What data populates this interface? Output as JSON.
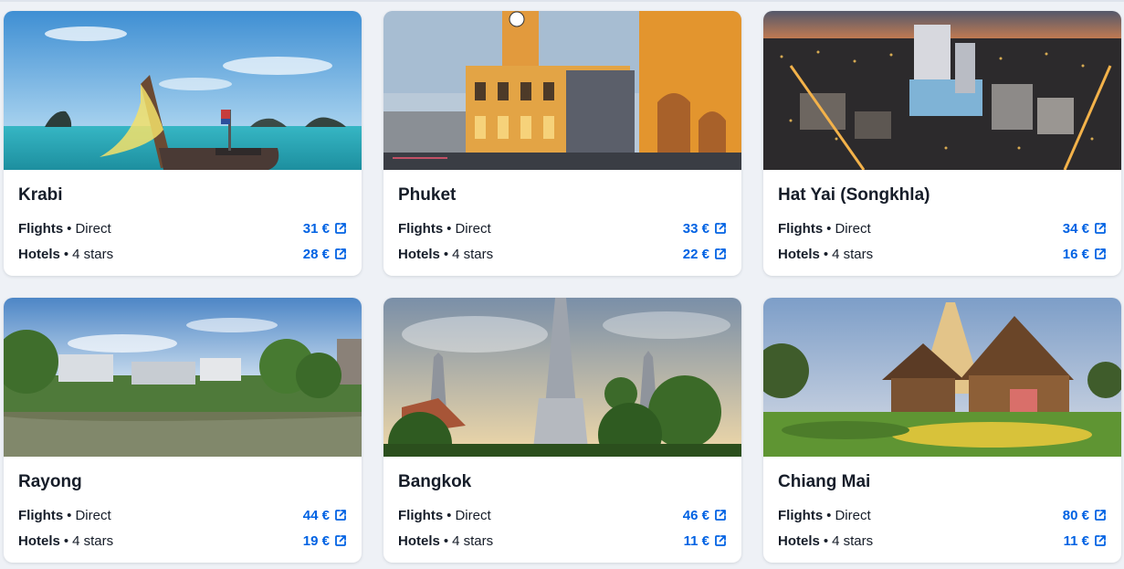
{
  "cards": [
    {
      "city": "Krabi",
      "flights_label": "Flights",
      "flights_detail": "Direct",
      "flights_price": "31 €",
      "hotels_label": "Hotels",
      "hotels_detail": "4 stars",
      "hotels_price": "28 €",
      "image": "krabi-beach-longtail-boat"
    },
    {
      "city": "Phuket",
      "flights_label": "Flights",
      "flights_detail": "Direct",
      "flights_price": "33 €",
      "hotels_label": "Hotels",
      "hotels_detail": "4 stars",
      "hotels_price": "22 €",
      "image": "phuket-old-town-clock-tower"
    },
    {
      "city": "Hat Yai (Songkhla)",
      "flights_label": "Flights",
      "flights_detail": "Direct",
      "flights_price": "34 €",
      "hotels_label": "Hotels",
      "hotels_detail": "4 stars",
      "hotels_price": "16 €",
      "image": "hat-yai-city-night"
    },
    {
      "city": "Rayong",
      "flights_label": "Flights",
      "flights_detail": "Direct",
      "flights_price": "44 €",
      "hotels_label": "Hotels",
      "hotels_detail": "4 stars",
      "hotels_price": "19 €",
      "image": "rayong-river-houses"
    },
    {
      "city": "Bangkok",
      "flights_label": "Flights",
      "flights_detail": "Direct",
      "flights_price": "46 €",
      "hotels_label": "Hotels",
      "hotels_detail": "4 stars",
      "hotels_price": "11 €",
      "image": "bangkok-wat-arun-temple"
    },
    {
      "city": "Chiang Mai",
      "flights_label": "Flights",
      "flights_detail": "Direct",
      "flights_price": "80 €",
      "hotels_label": "Hotels",
      "hotels_detail": "4 stars",
      "hotels_price": "11 €",
      "image": "chiang-mai-temple-garden"
    }
  ],
  "separator": "•",
  "colors": {
    "price": "#0062e3",
    "text": "#161d29",
    "background": "#eef1f6",
    "card": "#ffffff"
  },
  "icons": {
    "price_link": "external-link-icon"
  }
}
